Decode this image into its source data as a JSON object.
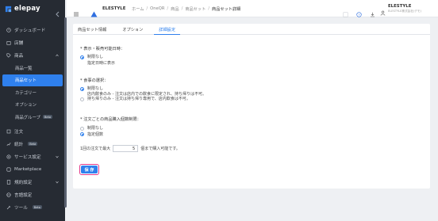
{
  "sidebar": {
    "brand": "elepay",
    "items": [
      {
        "label": "ダッシュボード",
        "icon": "clock-icon"
      },
      {
        "label": "店舗",
        "icon": "store-icon"
      },
      {
        "label": "商品",
        "icon": "tag-icon",
        "expanded": true
      },
      {
        "label": "注文",
        "icon": "cart-icon"
      },
      {
        "label": "統計",
        "icon": "chart-icon",
        "badge": "Beta"
      },
      {
        "label": "サービス設定",
        "icon": "settings-icon"
      },
      {
        "label": "Marketplace",
        "icon": "marketplace-icon"
      },
      {
        "label": "規約設定",
        "icon": "doc-icon"
      },
      {
        "label": "言語設定",
        "icon": "globe-icon"
      },
      {
        "label": "ツール",
        "icon": "tool-icon",
        "badge": "Beta"
      }
    ],
    "sub_items": [
      {
        "label": "商品一覧"
      },
      {
        "label": "商品セット",
        "active": true
      },
      {
        "label": "カテゴリー"
      },
      {
        "label": "オプション"
      },
      {
        "label": "商品グループ",
        "badge": "Beta"
      }
    ]
  },
  "header": {
    "shop_name": "ELESTYLE",
    "breadcrumb": [
      "ホーム",
      "OneQR",
      "商品",
      "商品セット",
      "商品セット詳細"
    ],
    "user_name": "ELESTYLE",
    "user_sub": "ELESTYLE株式会社(デモ)"
  },
  "tabs": [
    {
      "label": "商品セット情報",
      "active": false
    },
    {
      "label": "オプション",
      "active": false
    },
    {
      "label": "詳細設定",
      "active": true
    }
  ],
  "sections": {
    "display_period": {
      "title": "* 表示・販売可能日時：",
      "options": [
        {
          "label": "制限なし",
          "checked": true
        },
        {
          "label": "指定日時に表示",
          "checked": false
        }
      ]
    },
    "dining": {
      "title": "* 食事の選択：",
      "options": [
        {
          "label": "制限なし",
          "checked": true
        },
        {
          "label": "店内飲食のみ - 注文は店内での飲食に限定され、持ち帰りは不可。",
          "checked": false
        },
        {
          "label": "持ち帰りのみ - 注文は持ち帰り専用で、店内飲食は不可。",
          "checked": false
        }
      ]
    },
    "quantity_limit": {
      "title": "* 注文ごとの商品購入個数制限：",
      "options": [
        {
          "label": "制限なし",
          "checked": false
        },
        {
          "label": "指定個数",
          "checked": true
        }
      ],
      "qty_prefix": "1回の注文で最大",
      "qty_value": "5",
      "qty_suffix": "個まで購入可能です。"
    }
  },
  "save_label": "保 存"
}
